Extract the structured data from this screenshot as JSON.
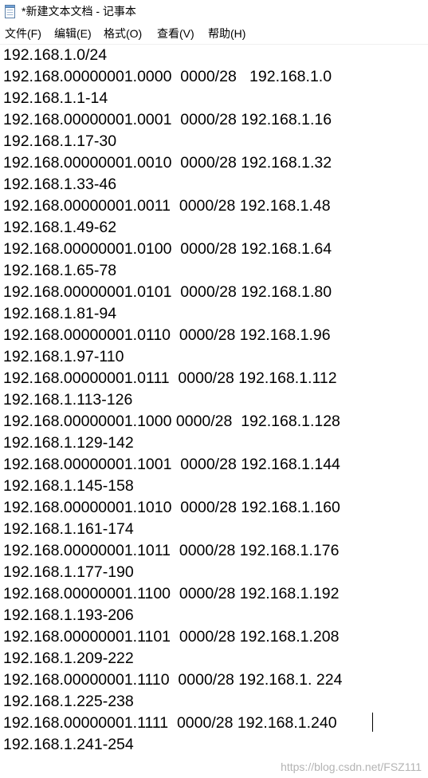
{
  "window": {
    "title": "*新建文本文档 - 记事本",
    "app_icon": "notepad-icon"
  },
  "menu": {
    "items": [
      {
        "label": "文件(F)"
      },
      {
        "label": "编辑(E)"
      },
      {
        "label": "格式(O)"
      },
      {
        "label": "查看(V)"
      },
      {
        "label": "帮助(H)"
      }
    ]
  },
  "editor": {
    "lines": [
      "192.168.1.0/24",
      "192.168.00000001.0000  0000/28   192.168.1.0",
      "192.168.1.1-14",
      "192.168.00000001.0001  0000/28 192.168.1.16",
      "192.168.1.17-30",
      "192.168.00000001.0010  0000/28 192.168.1.32",
      "192.168.1.33-46",
      "192.168.00000001.0011  0000/28 192.168.1.48",
      "192.168.1.49-62",
      "192.168.00000001.0100  0000/28 192.168.1.64",
      "192.168.1.65-78",
      "192.168.00000001.0101  0000/28 192.168.1.80",
      "192.168.1.81-94",
      "192.168.00000001.0110  0000/28 192.168.1.96",
      "192.168.1.97-110",
      "192.168.00000001.0111  0000/28 192.168.1.112",
      "192.168.1.113-126",
      "192.168.00000001.1000 0000/28  192.168.1.128",
      "192.168.1.129-142",
      "192.168.00000001.1001  0000/28 192.168.1.144",
      "192.168.1.145-158",
      "192.168.00000001.1010  0000/28 192.168.1.160",
      "192.168.1.161-174",
      "192.168.00000001.1011  0000/28 192.168.1.176",
      "192.168.1.177-190",
      "192.168.00000001.1100  0000/28 192.168.1.192",
      "192.168.1.193-206",
      "192.168.00000001.1101  0000/28 192.168.1.208",
      "192.168.1.209-222",
      "192.168.00000001.1110  0000/28 192.168.1. 224",
      "192.168.1.225-238",
      "192.168.00000001.1111  0000/28 192.168.1.240",
      "192.168.1.241-254"
    ]
  },
  "watermark": "https://blog.csdn.net/FSZ111"
}
